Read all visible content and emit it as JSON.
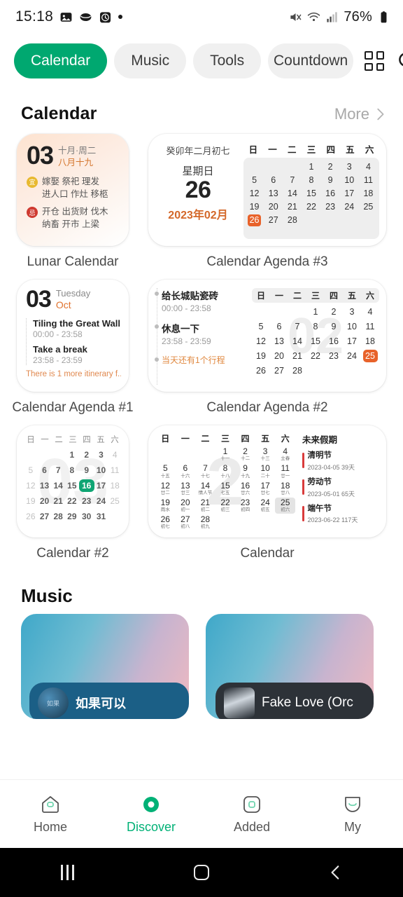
{
  "status_bar": {
    "time": "15:18",
    "icons": [
      "image-icon",
      "eye-icon",
      "alarm-icon",
      "dot-indicator"
    ],
    "right_icons": [
      "mute-icon",
      "wifi-icon",
      "signal-icon",
      "battery-icon"
    ],
    "battery": "76%"
  },
  "tabs": [
    {
      "label": "Calendar",
      "active": true
    },
    {
      "label": "Music",
      "active": false
    },
    {
      "label": "Tools",
      "active": false
    },
    {
      "label": "Countdown",
      "active": false
    }
  ],
  "tab_actions": {
    "grid": "grid-icon",
    "search": "search-icon"
  },
  "calendar_section": {
    "title": "Calendar",
    "more_label": "More"
  },
  "widgets": {
    "lunar_calendar": {
      "caption": "Lunar Calendar",
      "day": "03",
      "sub_line1": "十月·周二",
      "sub_line2": "八月十九",
      "yi_badge": "宜",
      "yi_line1": "嫁娶  祭祀  理发",
      "yi_line2": "进人口  作灶  移柩",
      "ji_badge": "忌",
      "ji_line1": "开仓  出货财  伐木",
      "ji_line2": "纳畜  开市  上梁"
    },
    "agenda3": {
      "caption": "Calendar Agenda #3",
      "lunar_date": "癸卯年二月初七",
      "weekday": "星期日",
      "day": "26",
      "year_month": "2023年02月",
      "weekday_headers": [
        "日",
        "一",
        "二",
        "三",
        "四",
        "五",
        "六"
      ],
      "days": [
        "",
        "",
        "",
        "1",
        "2",
        "3",
        "4",
        "5",
        "6",
        "7",
        "8",
        "9",
        "10",
        "11",
        "12",
        "13",
        "14",
        "15",
        "16",
        "17",
        "18",
        "19",
        "20",
        "21",
        "22",
        "23",
        "24",
        "25",
        "26",
        "27",
        "28",
        "",
        "",
        "",
        ""
      ],
      "selected": "26"
    },
    "agenda1": {
      "caption": "Calendar Agenda #1",
      "day": "03",
      "weekday": "Tuesday",
      "month": "Oct",
      "events": [
        {
          "name": "Tiling the Great Wall",
          "time": "00:00 - 23:58"
        },
        {
          "name": "Take a break",
          "time": "23:58 - 23:59"
        }
      ],
      "more_text": "There is 1 more itinerary f..."
    },
    "agenda2": {
      "caption": "Calendar Agenda #2",
      "events": [
        {
          "name": "给长城贴瓷砖",
          "time": "00:00 - 23:58"
        },
        {
          "name": "休息一下",
          "time": "23:58 - 23:59"
        }
      ],
      "footer": "当天还有1个行程",
      "watermark": "02",
      "weekday_headers": [
        "日",
        "一",
        "二",
        "三",
        "四",
        "五",
        "六"
      ],
      "days": [
        "",
        "",
        "",
        "1",
        "2",
        "3",
        "4",
        "5",
        "6",
        "7",
        "8",
        "9",
        "10",
        "11",
        "12",
        "13",
        "14",
        "15",
        "16",
        "17",
        "18",
        "19",
        "20",
        "21",
        "22",
        "23",
        "24",
        "25",
        "26",
        "27",
        "28",
        "",
        "",
        "",
        ""
      ],
      "selected": "25"
    },
    "calendar2": {
      "caption": "Calendar #2",
      "watermark": "03",
      "weekday_headers": [
        "日",
        "一",
        "二",
        "三",
        "四",
        "五",
        "六"
      ],
      "days": [
        "",
        "",
        "",
        "1",
        "2",
        "3",
        "4",
        "5",
        "6",
        "7",
        "8",
        "9",
        "10",
        "11",
        "12",
        "13",
        "14",
        "15",
        "16",
        "17",
        "18",
        "19",
        "20",
        "21",
        "22",
        "23",
        "24",
        "25",
        "26",
        "27",
        "28",
        "29",
        "30",
        "31",
        ""
      ],
      "dim_days": [
        "4",
        "5",
        "11",
        "12",
        "18",
        "19",
        "25",
        "26"
      ],
      "selected": "16"
    },
    "calendar_big": {
      "caption": "Calendar",
      "watermark": "2",
      "weekday_headers": [
        "日",
        "一",
        "二",
        "三",
        "四",
        "五",
        "六"
      ],
      "cells": [
        {
          "d": "",
          "l": ""
        },
        {
          "d": "",
          "l": ""
        },
        {
          "d": "",
          "l": ""
        },
        {
          "d": "1",
          "l": "十一"
        },
        {
          "d": "2",
          "l": "十二"
        },
        {
          "d": "3",
          "l": "十三"
        },
        {
          "d": "4",
          "l": "立春"
        },
        {
          "d": "5",
          "l": "十五"
        },
        {
          "d": "6",
          "l": "十六"
        },
        {
          "d": "7",
          "l": "十七"
        },
        {
          "d": "8",
          "l": "十八"
        },
        {
          "d": "9",
          "l": "十九"
        },
        {
          "d": "10",
          "l": "二十"
        },
        {
          "d": "11",
          "l": "廿一"
        },
        {
          "d": "12",
          "l": "廿二"
        },
        {
          "d": "13",
          "l": "廿三"
        },
        {
          "d": "14",
          "l": "情人节"
        },
        {
          "d": "15",
          "l": "七五"
        },
        {
          "d": "16",
          "l": "廿六"
        },
        {
          "d": "17",
          "l": "廿七"
        },
        {
          "d": "18",
          "l": "廿八"
        },
        {
          "d": "19",
          "l": "雨水"
        },
        {
          "d": "20",
          "l": "初一"
        },
        {
          "d": "21",
          "l": "初二"
        },
        {
          "d": "22",
          "l": "初三"
        },
        {
          "d": "23",
          "l": "初四"
        },
        {
          "d": "24",
          "l": "初五"
        },
        {
          "d": "25",
          "l": "初六"
        },
        {
          "d": "26",
          "l": "初七"
        },
        {
          "d": "27",
          "l": "初八"
        },
        {
          "d": "28",
          "l": "初九"
        },
        {
          "d": "",
          "l": ""
        },
        {
          "d": "",
          "l": ""
        },
        {
          "d": "",
          "l": ""
        },
        {
          "d": "",
          "l": ""
        }
      ],
      "highlighted": "25",
      "holidays_title": "未来假期",
      "holidays": [
        {
          "name": "清明节",
          "date": "2023-04-05 39天"
        },
        {
          "name": "劳动节",
          "date": "2023-05-01 65天"
        },
        {
          "name": "端午节",
          "date": "2023-06-22 117天"
        }
      ]
    }
  },
  "music_section": {
    "title": "Music",
    "cards": [
      {
        "title": "如果可以"
      },
      {
        "title": "Fake Love (Orc"
      }
    ]
  },
  "bottom_nav": [
    {
      "label": "Home",
      "icon": "home-icon",
      "active": false
    },
    {
      "label": "Discover",
      "icon": "discover-icon",
      "active": true
    },
    {
      "label": "Added",
      "icon": "added-icon",
      "active": false
    },
    {
      "label": "My",
      "icon": "profile-icon",
      "active": false
    }
  ],
  "android_nav": [
    "recents-button",
    "home-button",
    "back-button"
  ],
  "colors": {
    "accent_green": "#00a870",
    "accent_orange": "#e8622a",
    "holiday_red": "#d93b3b"
  }
}
